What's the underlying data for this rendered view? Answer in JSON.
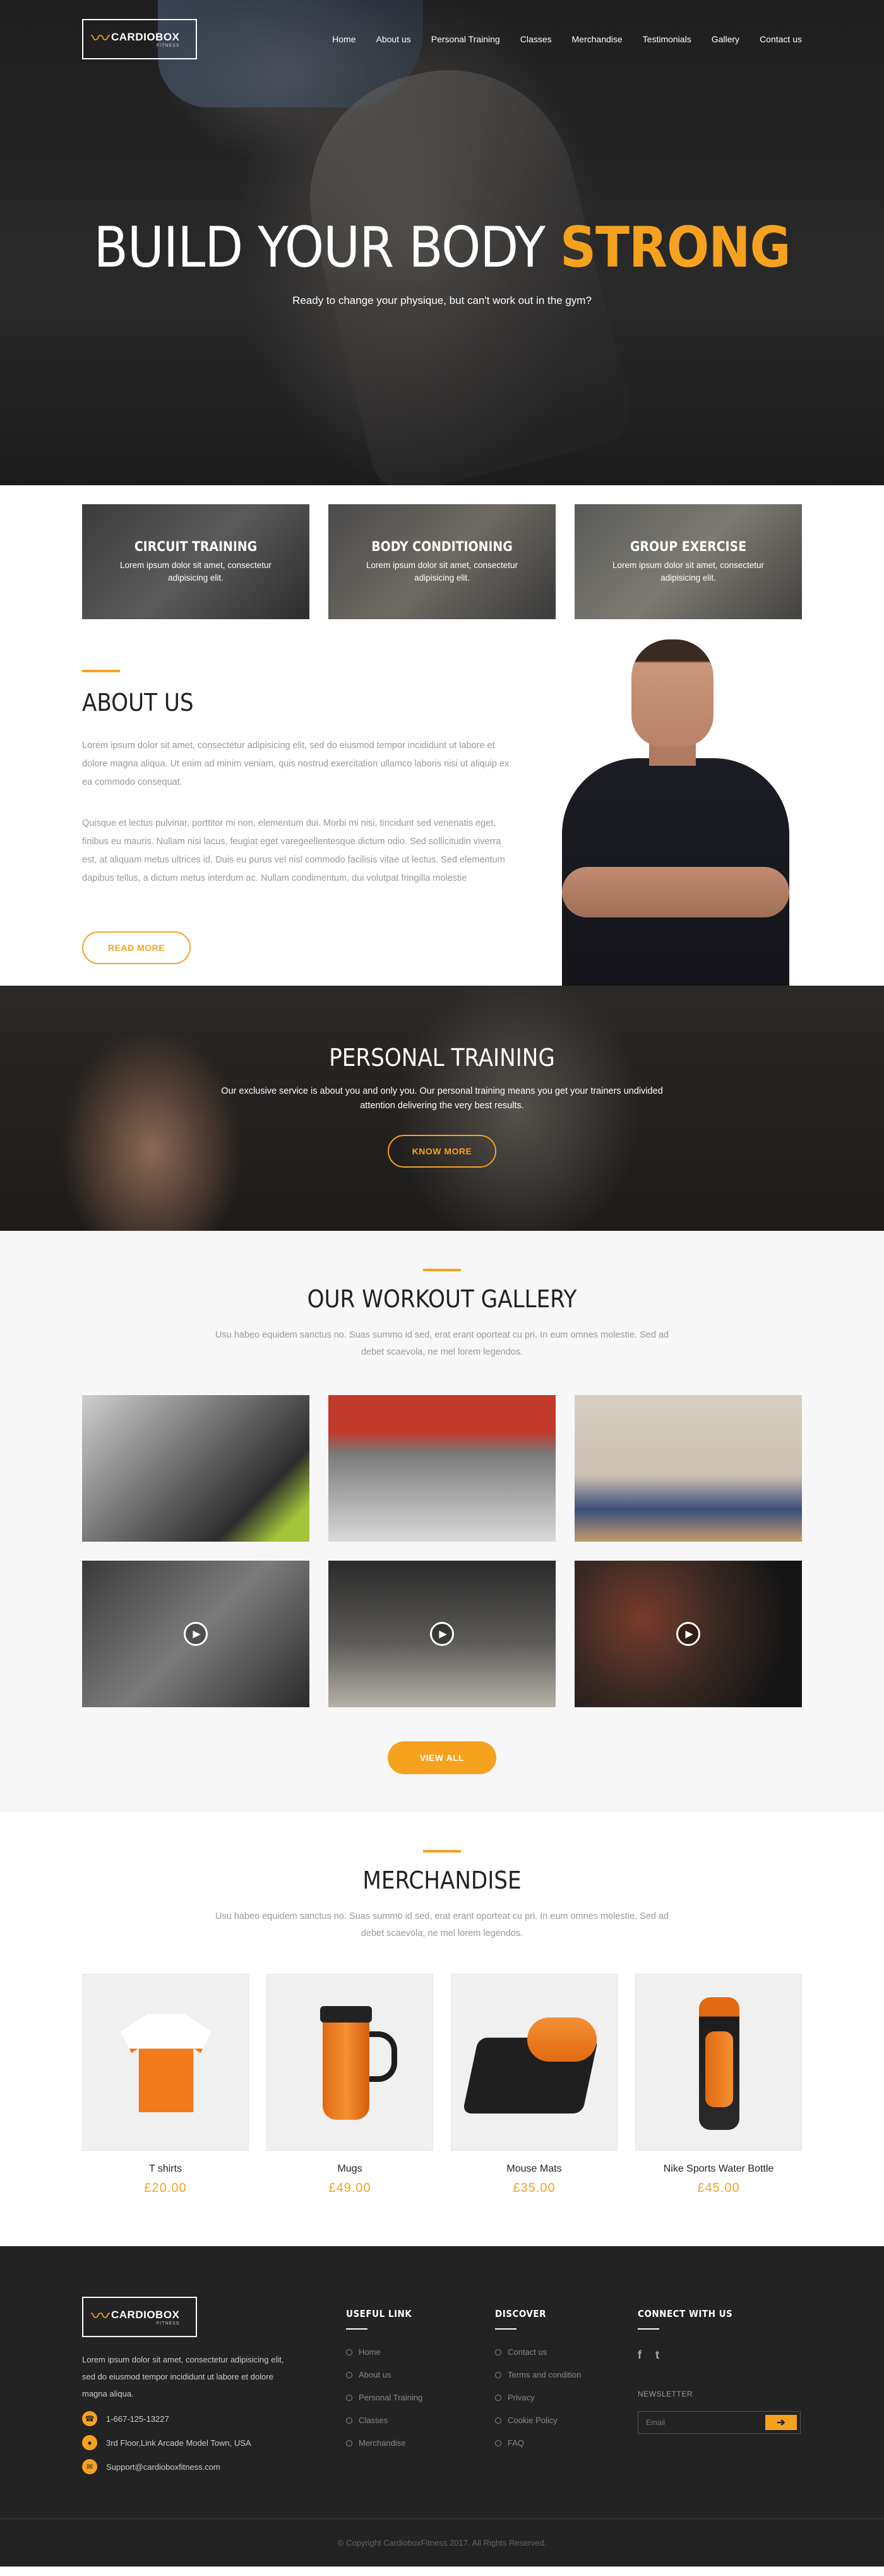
{
  "brand": {
    "name": "CARDIOBOX",
    "tagline": "FITNESS",
    "pulse": "〰"
  },
  "nav": [
    "Home",
    "About us",
    "Personal Training",
    "Classes",
    "Merchandise",
    "Testimonials",
    "Gallery",
    "Contact us"
  ],
  "hero": {
    "title_main": "BUILD YOUR BODY ",
    "title_accent": "STRONG",
    "subtitle": "Ready to change your physique, but can't work out in the gym?"
  },
  "services": [
    {
      "title": "CIRCUIT TRAINING",
      "text": "Lorem ipsum dolor sit amet, consectetur adipisicing elit."
    },
    {
      "title": "BODY CONDITIONING",
      "text": "Lorem ipsum dolor sit amet, consectetur adipisicing elit."
    },
    {
      "title": "GROUP EXERCISE",
      "text": "Lorem ipsum dolor sit amet, consectetur adipisicing elit."
    }
  ],
  "about": {
    "title": "ABOUT US",
    "p1": "Lorem ipsum dolor sit amet, consectetur adipisicing elit, sed do eiusmod tempor incididunt ut labore et dolore magna aliqua. Ut enim ad minim veniam, quis nostrud exercitation ullamco laboris nisi ut aliquip ex ea commodo consequat.",
    "p2": "Quisque et lectus pulvinar, porttitor mi non, elementum dui. Morbi mi nisi, tincidunt sed venenatis eget, finibus eu mauris. Nullam nisi lacus, feugiat eget varegeellentesque dictum odio. Sed sollicitudin viverra est, at aliquam metus ultrices id. Duis eu purus vel nisl commodo facilisis vitae ut lectus. Sed elementum dapibus tellus, a dictum metus interdum ac. Nullam condimentum, dui volutpat fringilla molestie",
    "button": "READ MORE"
  },
  "personal_training": {
    "title": "PERSONAL TRAINING",
    "text": "Our exclusive service is about you and only you. Our personal training means you get your trainers undivided attention delivering the very best results.",
    "button": "KNOW MORE"
  },
  "gallery": {
    "title": "OUR WORKOUT GALLERY",
    "text": "Usu habeo equidem sanctus no. Suas summo id sed, erat erant oporteat cu pri. In eum omnes molestie. Sed ad debet scaevola, ne mel lorem legendos.",
    "play_icon": "▶",
    "button": "VIEW ALL"
  },
  "merch": {
    "title": "MERCHANDISE",
    "text": "Usu habeo equidem sanctus no. Suas summo id sed, erat erant oporteat cu pri. In eum omnes molestie. Sed ad debet scaevola, ne mel lorem legendos.",
    "products": [
      {
        "name": "T shirts",
        "price": "£20.00"
      },
      {
        "name": "Mugs",
        "price": "£49.00"
      },
      {
        "name": "Mouse Mats",
        "price": "£35.00"
      },
      {
        "name": "Nike Sports Water Bottle",
        "price": "£45.00"
      }
    ]
  },
  "footer": {
    "intro": "Lorem ipsum dolor sit amet, consectetur adipisicing elit, sed do eiusmod tempor incididunt ut labore et dolore magna aliqua.",
    "phone": "1-667-125-13227",
    "address": "3rd Floor,Link Arcade Model Town, USA",
    "email": "Support@cardioboxfitness.com",
    "useful_title": "USEFUL LINK",
    "useful": [
      "Home",
      "About us",
      "Personal Training",
      "Classes",
      "Merchandise"
    ],
    "discover_title": "DISCOVER",
    "discover": [
      "Contact us",
      "Terms and condition",
      "Privacy",
      "Cookie Policy",
      "FAQ"
    ],
    "connect_title": "CONNECT WITH US",
    "facebook": "f",
    "twitter": "t",
    "newsletter": "NEWSLETTER",
    "email_placeholder": "Email",
    "submit": "➔",
    "copyright": "© Copyright CardioboxFitness 2017. All Rights Reserved."
  },
  "colors": {
    "accent": "#f6a21e",
    "dark": "#232323"
  }
}
